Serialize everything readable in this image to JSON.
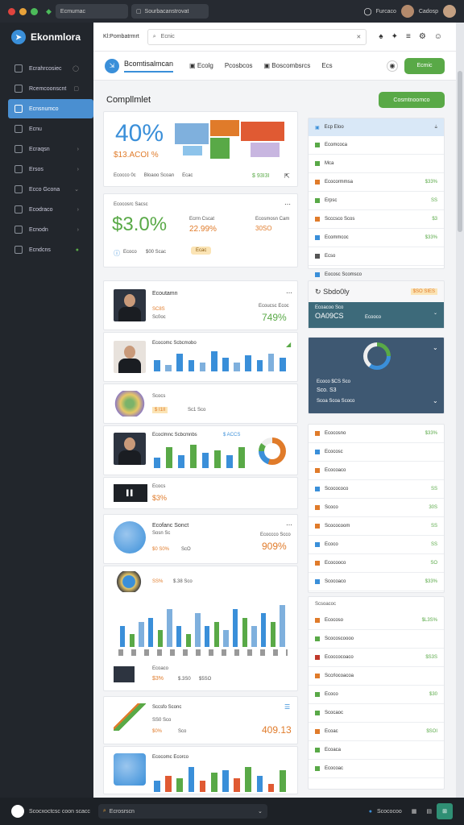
{
  "window": {
    "url": "Ecmumac",
    "tab": "Sourbacanstrovat",
    "user1": "Furcaco",
    "user2": "Cadosp"
  },
  "sidebar": {
    "brand": "Ekonmlora",
    "items": [
      {
        "label": "Ecrahrcosiec"
      },
      {
        "label": "Rcemcoonscnt"
      },
      {
        "label": "Ecnsnumco"
      },
      {
        "label": "Ecnu"
      },
      {
        "label": "Ecraqsn"
      },
      {
        "label": "Ersos"
      },
      {
        "label": "Ecco Gcona"
      },
      {
        "label": "Ecodraco"
      },
      {
        "label": "Ecnodn"
      },
      {
        "label": "Ecndcns"
      }
    ]
  },
  "topbar": {
    "crumb": "Kl:Pombatrmrt",
    "search": "Ecnic"
  },
  "subbar": {
    "title": "Bcomtisalmcan",
    "tabs": [
      "Ecolg",
      "Pcosbcos",
      "Boscombsrcs",
      "Ecs"
    ],
    "button": "Ecmic"
  },
  "section": {
    "title": "Compllmlet",
    "button": "Cosmtnoomco"
  },
  "kpi1": {
    "value": "40%",
    "sub": "$13.ACOI %",
    "foot": [
      "Ecocco 0c",
      "Bloaoo Scoan",
      "Ecac"
    ],
    "amount": "$ 93I3I"
  },
  "kpi2": {
    "header": "Ecocosrc Sacsc",
    "value": "$3.0%",
    "mid_label": "Ecrm Cscat",
    "mid_value": "22.99%",
    "right_label": "Ecosmosn Cam",
    "right_value": "30SO",
    "foot": "Ecoco",
    "foot2": "$00 Scac",
    "tag": "Ecac"
  },
  "panelA": {
    "title": "Ecp Eloo",
    "rows": [
      {
        "label": "Ecomcoca",
        "value": "",
        "color": "#59a947"
      },
      {
        "label": "Mca",
        "value": "",
        "color": "#59a947"
      },
      {
        "label": "Ecocormmsa",
        "value": "$33%",
        "color": "#e07b2a"
      },
      {
        "label": "Erpsc",
        "value": "SS",
        "color": "#59a947"
      },
      {
        "label": "Scccsco Scos",
        "value": "$3",
        "color": "#e07b2a"
      },
      {
        "label": "Ecommcoc",
        "value": "$33%",
        "color": "#3a8fd9"
      },
      {
        "label": "Ecso",
        "value": "",
        "color": "#555"
      },
      {
        "label": "Eocosc Scomsco",
        "value": "",
        "color": "#3a8fd9"
      }
    ]
  },
  "people": [
    {
      "name": "Ecoutamn",
      "sub": "SC8S",
      "sub2": "Sc0oc",
      "value": "749%",
      "rlabel": "Ecoucsc Ecoc"
    },
    {
      "name": "Ecocomc Scbcmobo",
      "value": ""
    },
    {
      "name": "Scocs",
      "sub": "$ I1II",
      "sub2": "Sc1 Sco"
    },
    {
      "name": "Ecoclmnc Scbcmnbs",
      "value": "$ ACCS"
    },
    {
      "name": "Ecocs",
      "sub": "$3%"
    }
  ],
  "world1": {
    "title": "Ecofanc Sonct",
    "l1": "Sosn Sc",
    "l2": "$0 S0%",
    "l3": "ScO",
    "rlabel": "Ecoccco Scco",
    "value": "909%"
  },
  "world2": {
    "title": "Ecoca",
    "v": "SS%",
    "s": "$.38 Sco"
  },
  "stat3": {
    "label": "Ecoaco",
    "value": "$3%",
    "v2": "$.3S0",
    "v3": "$5SO"
  },
  "bottomcard": {
    "title": "Sccsfo Sconc",
    "l1": "SS0 Sco",
    "l2": "$0%",
    "l3": "Sco",
    "value": "409.13"
  },
  "bottomcard2": {
    "title": "Ecocomc Ecorco"
  },
  "panelB": {
    "title": "Sbdo0ly",
    "val": "$SO SIES",
    "sub": "Ecoacoo Sco",
    "sub2": "Ecac",
    "amount": "OA09CS",
    "ag": "Ecooco"
  },
  "panelC": {
    "l1": "Ecoco $CS Sco",
    "l2": "Sco. S3",
    "l3": "Scoa Scoa Scoco"
  },
  "panelD": {
    "rows": [
      {
        "label": "Ecocosno",
        "value": "$33%",
        "color": "#e07b2a"
      },
      {
        "label": "Ecocosc",
        "value": "",
        "color": "#3a8fd9"
      },
      {
        "label": "Ecocoaco",
        "value": "",
        "color": "#e07b2a"
      },
      {
        "label": "Scocococo",
        "value": "SS",
        "color": "#3a8fd9"
      },
      {
        "label": "Scoco",
        "value": "30S",
        "color": "#e07b2a"
      },
      {
        "label": "Scococoom",
        "value": "SS",
        "color": "#e07b2a"
      },
      {
        "label": "Ecoco",
        "value": "SS",
        "color": "#3a8fd9"
      },
      {
        "label": "Ecocooco",
        "value": "SO",
        "color": "#e07b2a"
      },
      {
        "label": "Scocoaco",
        "value": "$33%",
        "color": "#3a8fd9"
      }
    ]
  },
  "panelE": {
    "header": "Scsoacoc",
    "rows": [
      {
        "label": "Ecocoso",
        "value": "$L3S%",
        "color": "#e07b2a"
      },
      {
        "label": "Scocoscoooo",
        "value": "",
        "color": "#59a947"
      },
      {
        "label": "Ecoccocoaco",
        "value": "$S3S",
        "color": "#c0392b"
      },
      {
        "label": "Sccrlocoacoa",
        "value": "",
        "color": "#e07b2a"
      },
      {
        "label": "Ecoco",
        "value": "$30",
        "color": "#59a947"
      },
      {
        "label": "Scocaoc",
        "value": "",
        "color": "#59a947"
      },
      {
        "label": "Ecoac",
        "value": "$SOI",
        "color": "#e07b2a"
      },
      {
        "label": "Ecoaca",
        "value": "",
        "color": "#59a947"
      },
      {
        "label": "Ecocoac",
        "value": "",
        "color": "#59a947"
      }
    ]
  },
  "bottom": {
    "left": "Scocxoctcsc coon scacc",
    "search": "Ecrosrscn",
    "right": "Scococoo"
  },
  "colors": {
    "accent": "#3a8fd9",
    "green": "#59a947",
    "orange": "#e07b2a",
    "panel": "#3e5872"
  }
}
